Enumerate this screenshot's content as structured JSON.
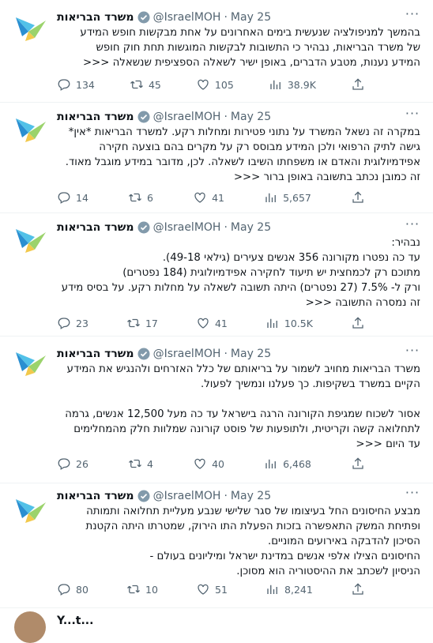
{
  "tweets": [
    {
      "name": "משרד הבריאות",
      "handle": "@IsraelMOH",
      "dot": "·",
      "date": "May 25",
      "text": "בהמשך למניפולציה שנעשית בימים האחרונים על אחת מבקשות חופש המידע\nשל משרד הבריאות, נבהיר כי התשובות לבקשות המוגשות תחת חוק חופש\nהמידע נענות, מטבע הדברים, באופן ישיר לשאלה הספציפית שנשאלה <<<",
      "replies": "134",
      "retweets": "45",
      "likes": "105",
      "views": "38.9K"
    },
    {
      "name": "משרד הבריאות",
      "handle": "@IsraelMOH",
      "dot": "·",
      "date": "May 25",
      "text": "במקרה זה נשאל המשרד על נתוני פטירות ומחלות רקע. למשרד הבריאות *אין*\nגישה לתיק הרפואי ולכן המידע מבוסס רק על מקרים בהם בוצעה חקירה\nאפידמיולוגית והאדם או משפחתו השיבו לשאלה. לכן, מדובר במידע מוגבל מאוד.\nזה כמובן נכתב בתשובה באופן ברור <<<",
      "replies": "14",
      "retweets": "6",
      "likes": "41",
      "views": "5,657"
    },
    {
      "name": "משרד הבריאות",
      "handle": "@IsraelMOH",
      "dot": "·",
      "date": "May 25",
      "text": "נבהיר:\nעד כה נפטרו מקורונה 356 אנשים צעירים (גילאי 49-18).\nמתוכם רק לכמחצית יש תיעוד לחקירה אפידמיולוגית (184 נפטרים)\nורק ל- 7.5% (27 נפטרים) היתה תשובה לשאלה על מחלות רקע. על בסיס מידע\nזה נמסרה התשובה <<<",
      "replies": "23",
      "retweets": "17",
      "likes": "41",
      "views": "10.5K"
    },
    {
      "name": "משרד הבריאות",
      "handle": "@IsraelMOH",
      "dot": "·",
      "date": "May 25",
      "text": "משרד הבריאות מחויב לשמור על בריאותם של כלל האזרחים ולהנגיש את המידע\nהקיים במשרד בשקיפות. כך פעלנו ונמשיך לפעול.\n\nאסור לשכוח שמגיפת הקורונה הרגה בישראל עד כה מעל 12,500 אנשים, גרמה\nלתחלואה קשה וקריטית, ולתופעות של פוסט קורונה שמלוות חלק מהמחלימים\nעד היום <<<",
      "replies": "26",
      "retweets": "4",
      "likes": "40",
      "views": "6,468"
    },
    {
      "name": "משרד הבריאות",
      "handle": "@IsraelMOH",
      "dot": "·",
      "date": "May 25",
      "text": "מבצע החיסונים החל בעיצומו של סגר שלישי שנבע מעליית תחלואה ותמותה\nופתיחת המשק התאפשרה בזכות הפעלת התו הירוק, שמטרתו היתה הקטנת\nהסיכון להדבקה באירועים המוניים.\nהחיסונים הצילו אלפי אנשים במדינת ישראל ומיליונים בעולם -\nהניסיון לשכתב את ההיסטוריה הוא מסוכן.",
      "replies": "80",
      "retweets": "10",
      "likes": "51",
      "views": "8,241"
    }
  ],
  "next_tweet": {
    "name": "Y...t..."
  },
  "colors": {
    "accent": "#1d9bf0",
    "muted": "#536471",
    "text": "#0f1419",
    "divider": "#eff3f4"
  }
}
